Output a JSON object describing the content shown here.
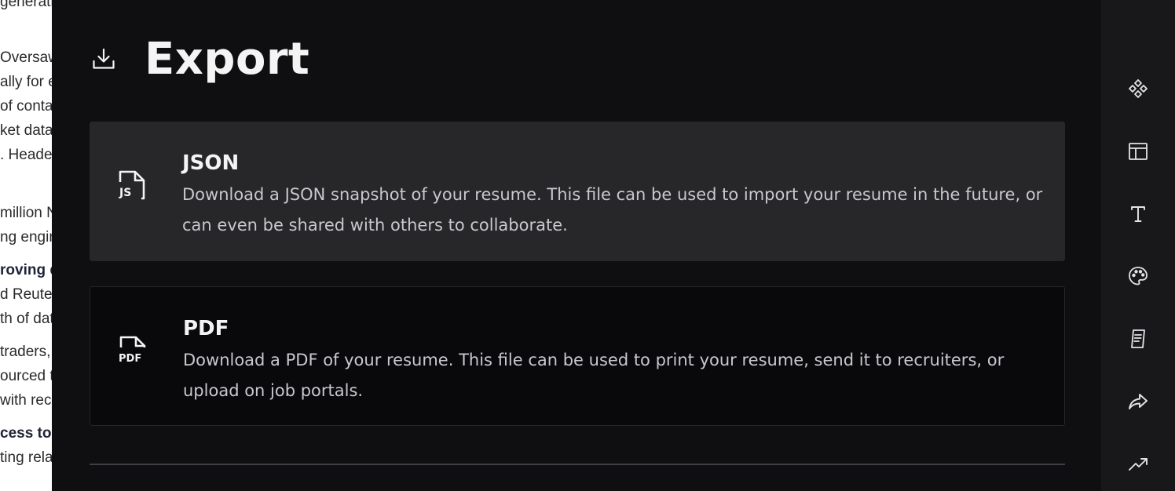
{
  "resume_preview": {
    "lines": [
      {
        "text": "generati",
        "bold": false
      },
      {
        "text": "Oversaw",
        "bold": false
      },
      {
        "text": "ally for e",
        "bold": false
      },
      {
        "text": "of conta",
        "bold": false
      },
      {
        "text": "ket data",
        "bold": false
      },
      {
        "text": ". Heade",
        "bold": false
      },
      {
        "text": "million N",
        "bold": false
      },
      {
        "text": "ng engin",
        "bold": false
      },
      {
        "text": "roving d",
        "bold": true
      },
      {
        "text": "d Reuter",
        "bold": false
      },
      {
        "text": "th of dat",
        "bold": false
      },
      {
        "text": "traders,",
        "bold": false
      },
      {
        "text": "ourced t",
        "bold": false
      },
      {
        "text": "with recr",
        "bold": false
      },
      {
        "text": "cess to s",
        "bold": true
      },
      {
        "text": "ting rela",
        "bold": false
      }
    ]
  },
  "panel": {
    "header_icon": "download-icon",
    "title": "Export"
  },
  "options": {
    "json": {
      "icon": "json-file-icon",
      "icon_text": "JS",
      "title": "JSON",
      "description": "Download a JSON snapshot of your resume. This file can be used to import your resume in the future, or can even be shared with others to collaborate."
    },
    "pdf": {
      "icon": "pdf-file-icon",
      "icon_text": "PDF",
      "title": "PDF",
      "description": "Download a PDF of your resume. This file can be used to print your resume, send it to recruiters, or upload on job portals."
    }
  },
  "sidebar": {
    "items": [
      {
        "icon": "sections-icon"
      },
      {
        "icon": "layout-icon"
      },
      {
        "icon": "typography-icon"
      },
      {
        "icon": "theme-palette-icon"
      },
      {
        "icon": "notes-icon"
      },
      {
        "icon": "share-icon"
      },
      {
        "icon": "statistics-icon"
      }
    ]
  },
  "colors": {
    "panel_bg": "#0f0f11",
    "card_active": "#27272a",
    "card_default": "#09090b",
    "text_primary": "#f4f4f5",
    "text_secondary": "#c8c8cd",
    "sidebar_bg": "#18181b"
  }
}
